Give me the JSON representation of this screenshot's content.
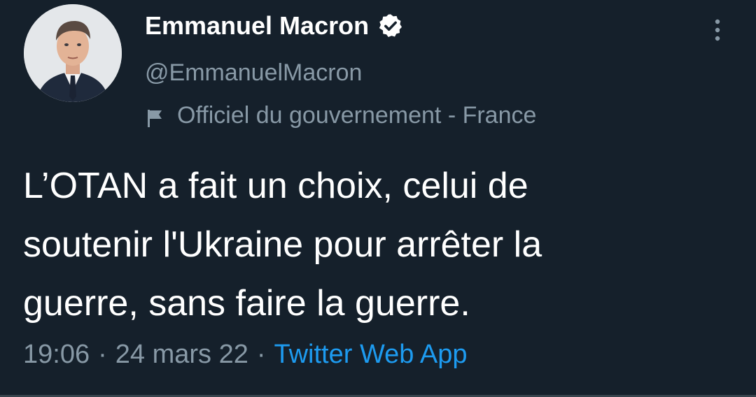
{
  "author": {
    "display_name": "Emmanuel Macron",
    "handle": "@EmmanuelMacron",
    "verified": true,
    "label": "Officiel du gouvernement - France"
  },
  "tweet": {
    "text_lines": [
      "L’OTAN a fait un choix, celui de",
      "soutenir l'Ukraine pour arrêter la",
      "guerre, sans faire la guerre."
    ],
    "time": "19:06",
    "date": "24 mars 22",
    "separator": "·",
    "source": "Twitter Web App"
  },
  "icons": {
    "verified": "verified-badge-icon",
    "label": "flag-icon",
    "menu": "more-vertical-icon"
  },
  "colors": {
    "background": "#15202b",
    "primary_text": "#ffffff",
    "secondary_text": "#8899a6",
    "link": "#1d9bf0"
  }
}
